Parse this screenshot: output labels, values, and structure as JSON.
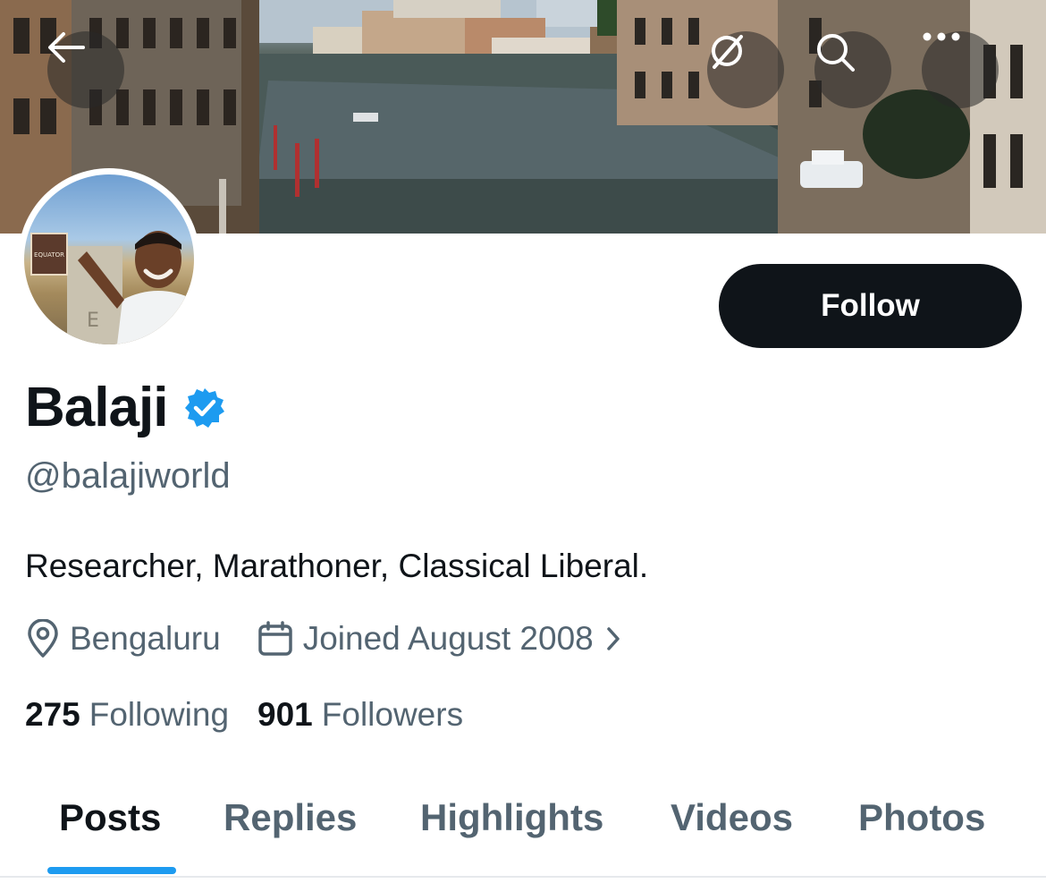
{
  "header": {
    "back_icon": "arrow-left-icon",
    "actions": [
      {
        "icon": "translate-disabled-icon"
      },
      {
        "icon": "search-icon"
      },
      {
        "icon": "more-icon"
      }
    ]
  },
  "profile": {
    "display_name": "Balaji",
    "verified": true,
    "verified_color": "#1d9bf0",
    "handle": "@balajiworld",
    "bio": "Researcher, Marathoner, Classical Liberal.",
    "location": "Bengaluru",
    "joined": "Joined August 2008",
    "following_count": "275",
    "following_label": "Following",
    "followers_count": "901",
    "followers_label": "Followers",
    "avatar_sign_text": "EQUATOR"
  },
  "follow_button": {
    "label": "Follow"
  },
  "tabs": [
    {
      "label": "Posts",
      "active": true
    },
    {
      "label": "Replies",
      "active": false
    },
    {
      "label": "Highlights",
      "active": false
    },
    {
      "label": "Videos",
      "active": false
    },
    {
      "label": "Photos",
      "active": false
    }
  ],
  "colors": {
    "accent": "#1d9bf0",
    "text_primary": "#0f1419",
    "text_secondary": "#536471",
    "button_dark": "#0f1419"
  }
}
